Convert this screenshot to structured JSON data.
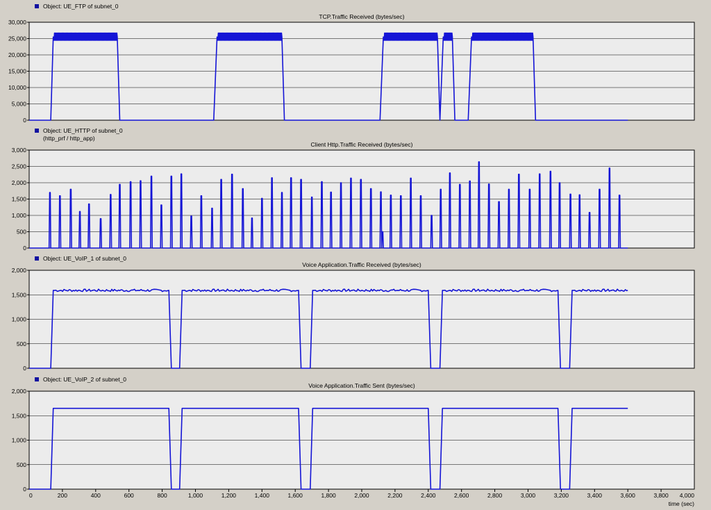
{
  "colors": {
    "background": "#d4d0c8",
    "plot_area": "#ececec",
    "series": "#1515d6",
    "grid": "#000000"
  },
  "x_axis": {
    "label": "time (sec)",
    "range": [
      0,
      4000
    ],
    "ticks": [
      "0",
      "200",
      "400",
      "600",
      "800",
      "1,000",
      "1,200",
      "1,400",
      "1,600",
      "1,800",
      "2,000",
      "2,200",
      "2,400",
      "2,600",
      "2,800",
      "3,000",
      "3,200",
      "3,400",
      "3,600",
      "3,800",
      "4,000"
    ]
  },
  "chart_data": [
    {
      "type": "line",
      "object_label": "Object: UE_FTP of subnet_0",
      "object_sublabel": "",
      "title": "TCP.Traffic Received (bytes/sec)",
      "ylim": [
        0,
        30000
      ],
      "yticks": [
        "0",
        "5,000",
        "10,000",
        "15,000",
        "20,000",
        "25,000",
        "30,000"
      ],
      "pattern": "ftp",
      "series": [
        {
          "points": [
            [
              0,
              0
            ],
            [
              130,
              0
            ],
            [
              145,
              25500
            ],
            [
              530,
              25500
            ],
            [
              545,
              0
            ],
            [
              1110,
              0
            ],
            [
              1130,
              25500
            ],
            [
              1520,
              25500
            ],
            [
              1535,
              0
            ],
            [
              2110,
              0
            ],
            [
              2130,
              25500
            ],
            [
              2455,
              25500
            ],
            [
              2470,
              0
            ],
            [
              2490,
              25500
            ],
            [
              2545,
              25500
            ],
            [
              2560,
              0
            ],
            [
              2640,
              0
            ],
            [
              2660,
              25500
            ],
            [
              3030,
              25500
            ],
            [
              3045,
              0
            ],
            [
              3600,
              0
            ]
          ]
        }
      ]
    },
    {
      "type": "line",
      "object_label": "Object: UE_HTTP of subnet_0",
      "object_sublabel": "(http_prf / http_app)",
      "title": "Client Http.Traffic Received (bytes/sec)",
      "ylim": [
        0,
        3000
      ],
      "yticks": [
        "0",
        "500",
        "1,000",
        "1,500",
        "2,000",
        "2,500",
        "3,000"
      ],
      "pattern": "spikes",
      "series": [
        {
          "spikes": [
            [
              125,
              1700
            ],
            [
              185,
              1600
            ],
            [
              250,
              1800
            ],
            [
              305,
              1120
            ],
            [
              360,
              1350
            ],
            [
              430,
              900
            ],
            [
              490,
              1640
            ],
            [
              545,
              1950
            ],
            [
              610,
              2030
            ],
            [
              670,
              2060
            ],
            [
              735,
              2200
            ],
            [
              795,
              1320
            ],
            [
              855,
              2200
            ],
            [
              915,
              2270
            ],
            [
              975,
              980
            ],
            [
              1035,
              1600
            ],
            [
              1100,
              1220
            ],
            [
              1155,
              2100
            ],
            [
              1220,
              2260
            ],
            [
              1285,
              1820
            ],
            [
              1340,
              920
            ],
            [
              1400,
              1520
            ],
            [
              1460,
              2150
            ],
            [
              1520,
              1700
            ],
            [
              1575,
              2150
            ],
            [
              1635,
              2100
            ],
            [
              1700,
              1560
            ],
            [
              1760,
              2030
            ],
            [
              1815,
              1710
            ],
            [
              1875,
              2000
            ],
            [
              1935,
              2140
            ],
            [
              1995,
              2100
            ],
            [
              2055,
              1820
            ],
            [
              2115,
              1720
            ],
            [
              2125,
              500
            ],
            [
              2175,
              1620
            ],
            [
              2235,
              1600
            ],
            [
              2295,
              2140
            ],
            [
              2355,
              1600
            ],
            [
              2420,
              1000
            ],
            [
              2475,
              1800
            ],
            [
              2530,
              2300
            ],
            [
              2590,
              1950
            ],
            [
              2650,
              2050
            ],
            [
              2705,
              2640
            ],
            [
              2765,
              1960
            ],
            [
              2825,
              1420
            ],
            [
              2885,
              1800
            ],
            [
              2945,
              2260
            ],
            [
              3010,
              1800
            ],
            [
              3070,
              2270
            ],
            [
              3135,
              2350
            ],
            [
              3190,
              2000
            ],
            [
              3255,
              1650
            ],
            [
              3310,
              1630
            ],
            [
              3370,
              1090
            ],
            [
              3430,
              1800
            ],
            [
              3490,
              2450
            ],
            [
              3550,
              1620
            ]
          ]
        }
      ]
    },
    {
      "type": "line",
      "object_label": "Object: UE_VoIP_1 of subnet_0",
      "object_sublabel": "",
      "title": "Voice Application.Traffic Received (bytes/sec)",
      "ylim": [
        0,
        2000
      ],
      "yticks": [
        "0",
        "500",
        "1,000",
        "1,500",
        "2,000"
      ],
      "pattern": "voip-noisy",
      "series": [
        {
          "points": [
            [
              0,
              0
            ],
            [
              130,
              0
            ],
            [
              145,
              1590
            ],
            [
              840,
              1590
            ],
            [
              855,
              0
            ],
            [
              905,
              0
            ],
            [
              920,
              1590
            ],
            [
              1620,
              1590
            ],
            [
              1635,
              0
            ],
            [
              1690,
              0
            ],
            [
              1705,
              1590
            ],
            [
              2400,
              1590
            ],
            [
              2415,
              0
            ],
            [
              2470,
              0
            ],
            [
              2485,
              1590
            ],
            [
              3180,
              1590
            ],
            [
              3195,
              0
            ],
            [
              3250,
              0
            ],
            [
              3265,
              1590
            ],
            [
              3600,
              1590
            ]
          ]
        }
      ]
    },
    {
      "type": "line",
      "object_label": "Object: UE_VoIP_2 of subnet_0",
      "object_sublabel": "",
      "title": "Voice Application.Traffic Sent (bytes/sec)",
      "ylim": [
        0,
        2000
      ],
      "yticks": [
        "0",
        "500",
        "1,000",
        "1,500",
        "2,000"
      ],
      "pattern": "voip",
      "series": [
        {
          "points": [
            [
              0,
              0
            ],
            [
              130,
              0
            ],
            [
              145,
              1650
            ],
            [
              840,
              1650
            ],
            [
              855,
              0
            ],
            [
              905,
              0
            ],
            [
              920,
              1650
            ],
            [
              1620,
              1650
            ],
            [
              1635,
              0
            ],
            [
              1690,
              0
            ],
            [
              1705,
              1650
            ],
            [
              2400,
              1650
            ],
            [
              2415,
              0
            ],
            [
              2470,
              0
            ],
            [
              2485,
              1650
            ],
            [
              3180,
              1650
            ],
            [
              3195,
              0
            ],
            [
              3250,
              0
            ],
            [
              3265,
              1650
            ],
            [
              3600,
              1650
            ]
          ]
        }
      ]
    }
  ]
}
